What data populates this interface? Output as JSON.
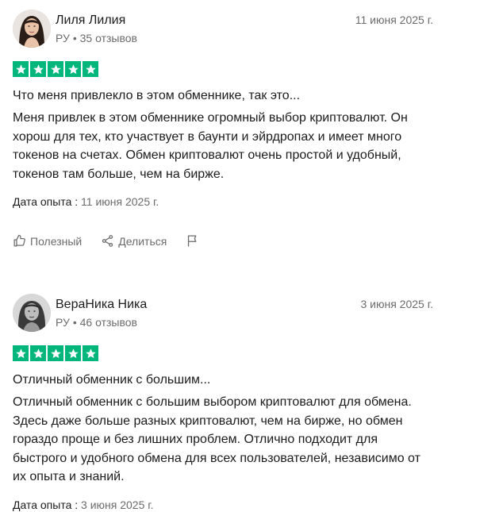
{
  "reviews": [
    {
      "author": "Лиля Лилия",
      "country": "РУ",
      "reviews_count": "35 отзывов",
      "date": "11 июня 2025 г.",
      "rating": 5,
      "title": "Что меня привлекло в этом обменнике, так это...",
      "text": "Меня привлек в этом обменнике огромный выбор криптовалют. Он хорош для тех, кто участвует в баунти и эйрдропах и имеет много токенов на счетах. Обмен криптовалют очень простой и удобный, токенов там больше, чем на бирже.",
      "experience_label": "Дата опыта :",
      "experience_date": "11 июня 2025 г."
    },
    {
      "author": "ВераНика Ника",
      "country": "РУ",
      "reviews_count": "46 отзывов",
      "date": "3 июня 2025 г.",
      "rating": 5,
      "title": "Отличный обменник с большим...",
      "text": "Отличный обменник с большим выбором криптовалют для обмена. Здесь даже больше разных криптовалют, чем на бирже, но обмен гораздо проще и без лишних проблем. Отлично подходит для быстрого и удобного обмена для всех пользователей, независимо от их опыта и знаний.",
      "experience_label": "Дата опыта :",
      "experience_date": "3 июня 2025 г."
    }
  ],
  "actions": {
    "useful": "Полезный",
    "share": "Делиться"
  },
  "colors": {
    "star_bg": "#00b67a",
    "muted": "#6b6b6b"
  }
}
